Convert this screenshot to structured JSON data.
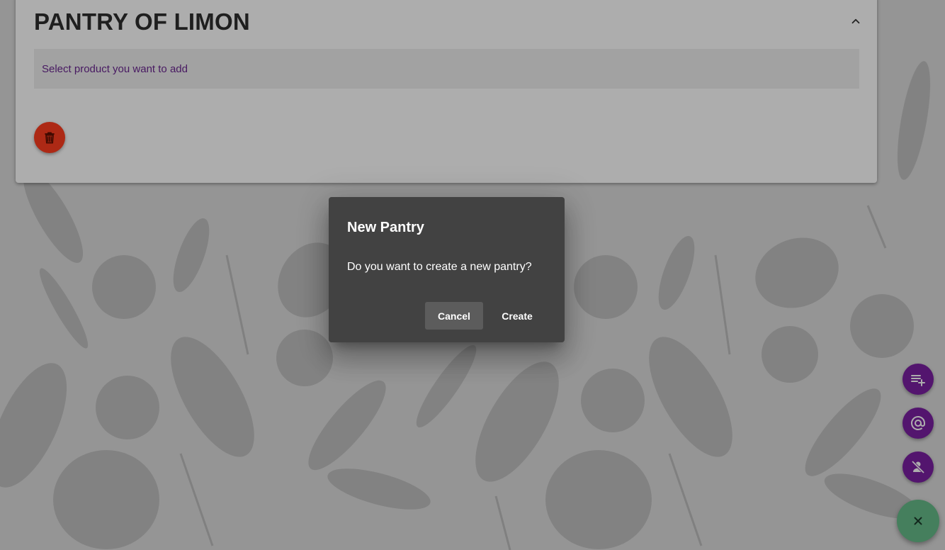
{
  "pantry": {
    "title": "PANTRY OF LIMON",
    "select_placeholder": "Select product you want to add",
    "collapse_icon": "chevron-up-icon",
    "delete_icon": "trash-icon"
  },
  "fab_menu": {
    "items": [
      {
        "icon": "playlist-add-icon"
      },
      {
        "icon": "at-sign-icon"
      },
      {
        "icon": "person-off-icon"
      }
    ],
    "main_icon": "close-icon"
  },
  "dialog": {
    "title": "New Pantry",
    "message": "Do you want to create a new pantry?",
    "cancel_label": "Cancel",
    "create_label": "Create"
  },
  "colors": {
    "accent_purple": "#7b1fa2",
    "delete_red": "#ff3d1f",
    "fab_green": "#66bb8a",
    "dialog_bg": "#424242",
    "placeholder_text": "#6b2791"
  }
}
